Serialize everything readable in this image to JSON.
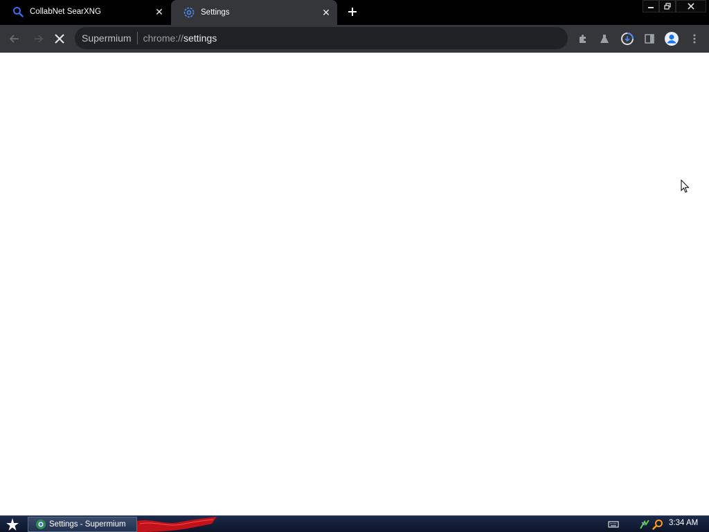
{
  "tabs": [
    {
      "title": "CollabNet SearXNG",
      "icon": "search-icon",
      "active": false
    },
    {
      "title": "Settings",
      "icon": "settings-favicon-icon",
      "active": true
    }
  ],
  "toolbar": {
    "omnibox": {
      "chip": "Supermium",
      "url_scheme": "chrome://",
      "url_host": "settings"
    }
  },
  "taskbar": {
    "task_label": "Settings - Supermium",
    "clock": "3:34 AM"
  },
  "colors": {
    "tabstrip_bg": "#000000",
    "toolbar_bg": "#35363a",
    "omnibox_bg": "#202124",
    "content_bg": "#ffffff",
    "taskbar_bg": "#0c1428",
    "accent": "#1a73e8"
  }
}
